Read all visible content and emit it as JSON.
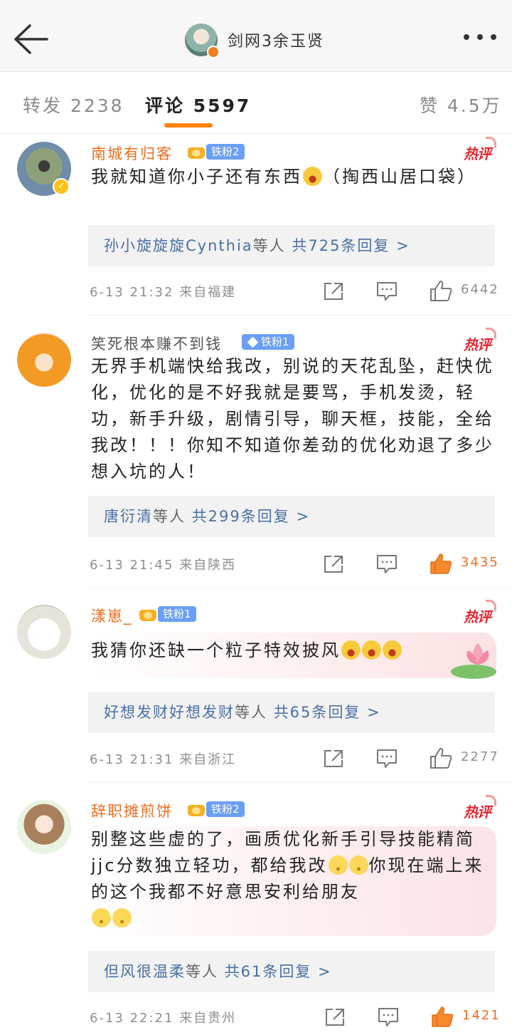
{
  "header": {
    "title": "剑网3余玉贤"
  },
  "tabs": {
    "repost": "转发 2238",
    "comments": "评论 5597",
    "likes": "赞 4.5万"
  },
  "hot_label": "热评",
  "comments": [
    {
      "username": "南城有归客",
      "fan_badge": "铁粉2",
      "text_before_emoji": "我就知道你小子还有东西",
      "text_after_emoji": "（掏西山居口袋）",
      "replies": {
        "names": "孙小旋旋旋Cynthia",
        "suffix": "等人",
        "count": "共725条回复",
        "arrow": ">"
      },
      "time": "6-13 21:32",
      "location": "来自福建",
      "likes": "6442",
      "liked": false
    },
    {
      "username": "笑死根本赚不到钱",
      "fan_badge": "铁粉1",
      "text": "无界手机端快给我改，别说的天花乱坠，赶快优化，优化的是不好我就是要骂，手机发烫，轻功，新手升级，剧情引导，聊天框，技能，全给我改！！！你知不知道你差劲的优化劝退了多少想入坑的人！",
      "replies": {
        "names": "唐衍清",
        "suffix": "等人",
        "count": "共299条回复",
        "arrow": ">"
      },
      "time": "6-13 21:45",
      "location": "来自陕西",
      "likes": "3435",
      "liked": true
    },
    {
      "username": "漾崽_",
      "fan_badge": "铁粉1",
      "text": "我猜你还缺一个粒子特效披风",
      "replies": {
        "names": "好想发财好想发财",
        "suffix": "等人",
        "count": "共65条回复",
        "arrow": ">"
      },
      "time": "6-13 21:31",
      "location": "来自浙江",
      "likes": "2277",
      "liked": false
    },
    {
      "username": "辞职摊煎饼",
      "fan_badge": "铁粉2",
      "text_part1": "别整这些虚的了，画质优化新手引导技能精简jjc分数独立轻功，都给我改",
      "text_part2": "你现在端上来的这个我都不好意思安利给朋友",
      "replies": {
        "names": "但风很温柔",
        "suffix": "等人",
        "count": "共61条回复",
        "arrow": ">"
      },
      "time": "6-13 22:21",
      "location": "来自贵州",
      "likes": "1421",
      "liked": true
    }
  ],
  "colors": {
    "accent_orange": "#ff8200",
    "username_orange": "#ee6c1d",
    "hot_red": "#e8262f",
    "reply_link": "#4a6fa5",
    "meta_gray": "#8e8e8e"
  },
  "icons": [
    "back-arrow-icon",
    "more-icon",
    "verified-icon",
    "crown-icon",
    "diamond-icon",
    "share-icon",
    "comment-icon",
    "like-icon",
    "laugh-emoji-icon",
    "smile-emoji-icon",
    "lotus-decoration"
  ]
}
